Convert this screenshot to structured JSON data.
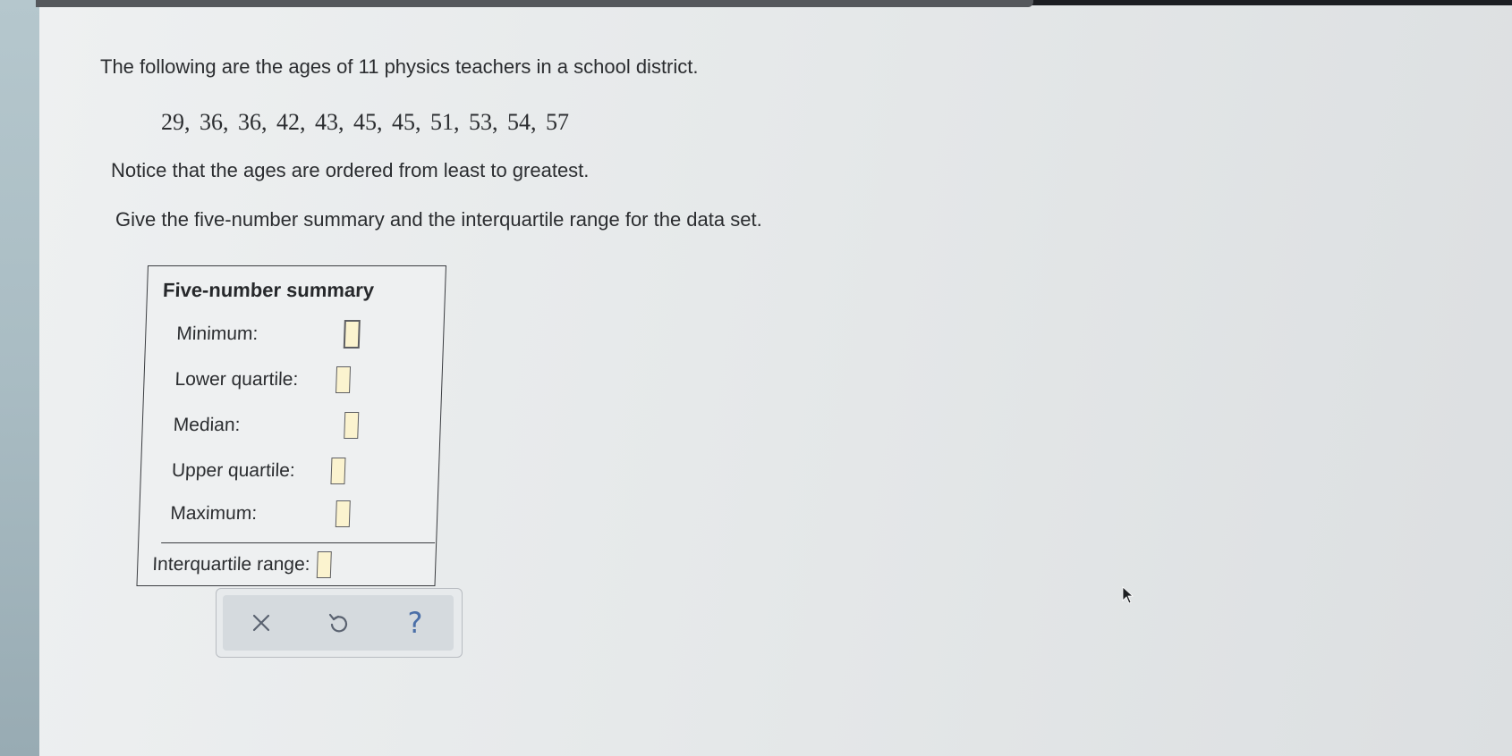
{
  "problem": {
    "intro": "The following are the ages of 11 physics teachers in a school district.",
    "data_values": "29, 36, 36, 42, 43, 45, 45, 51, 53, 54, 57",
    "notice": "Notice that the ages are ordered from least to greatest.",
    "instruction": "Give the five-number summary and the interquartile range for the data set."
  },
  "summary_table": {
    "title": "Five-number summary",
    "rows": [
      {
        "label": "Minimum:",
        "value": ""
      },
      {
        "label": "Lower quartile:",
        "value": ""
      },
      {
        "label": "Median:",
        "value": ""
      },
      {
        "label": "Upper quartile:",
        "value": ""
      },
      {
        "label": "Maximum:",
        "value": ""
      }
    ],
    "iqr": {
      "label": "Interquartile range:",
      "value": ""
    }
  },
  "toolbar": {
    "clear_icon": "close-icon",
    "undo_icon": "undo-icon",
    "help_glyph": "?"
  },
  "colors": {
    "input_fill": "#fbf3cf",
    "help_blue": "#4b6fa8"
  }
}
